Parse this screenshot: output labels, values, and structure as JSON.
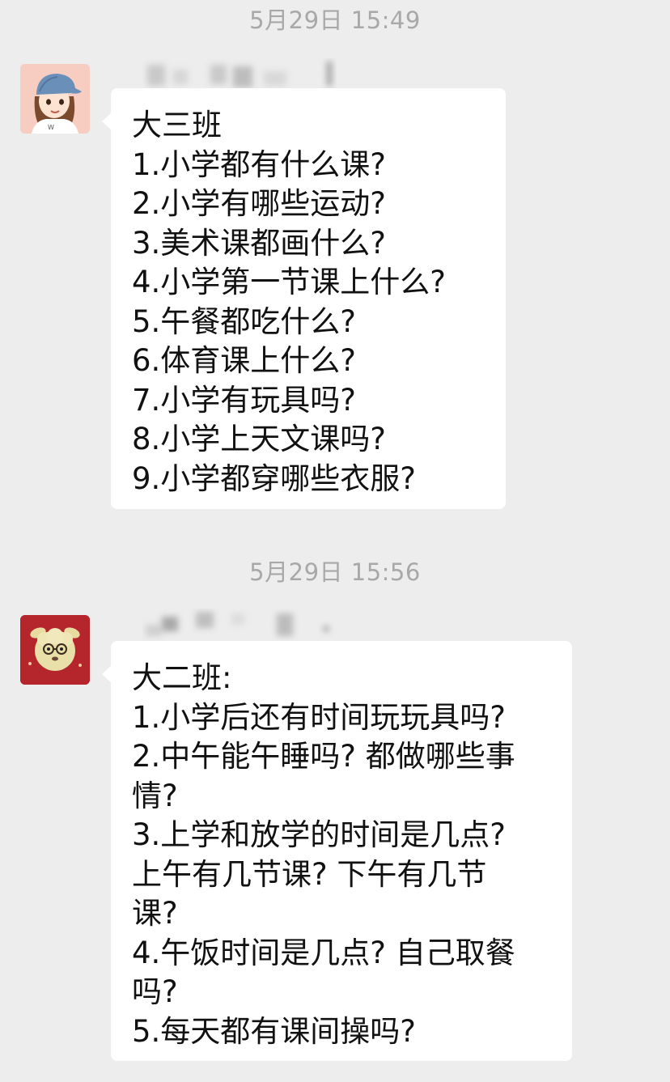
{
  "chat": {
    "messages": [
      {
        "timestamp": "5月29日 15:49",
        "lines": [
          "大三班",
          "1.小学都有什么课?",
          "2.小学有哪些运动?",
          "3.美术课都画什么?",
          "4.小学第一节课上什么?",
          "5.午餐都吃什么?",
          "6.体育课上什么?",
          "7.小学有玩具吗?",
          "8.小学上天文课吗?",
          "9.小学都穿哪些衣服?"
        ]
      },
      {
        "timestamp": "5月29日 15:56",
        "lines": [
          "大二班:",
          "1.小学后还有时间玩玩具吗?",
          "2.中午能午睡吗? 都做哪些事",
          "情?",
          "3.上学和放学的时间是几点?",
          "上午有几节课? 下午有几节",
          "课?",
          "4.午饭时间是几点? 自己取餐",
          "吗?",
          "5.每天都有课间操吗?"
        ]
      }
    ]
  },
  "colors": {
    "background": "#ededed",
    "bubble": "#ffffff",
    "text": "#111111",
    "timestamp": "#a8a8a8"
  },
  "icons": {
    "avatar1": "girl-with-cap-avatar-icon",
    "avatar2": "alpaca-plush-avatar-icon"
  }
}
